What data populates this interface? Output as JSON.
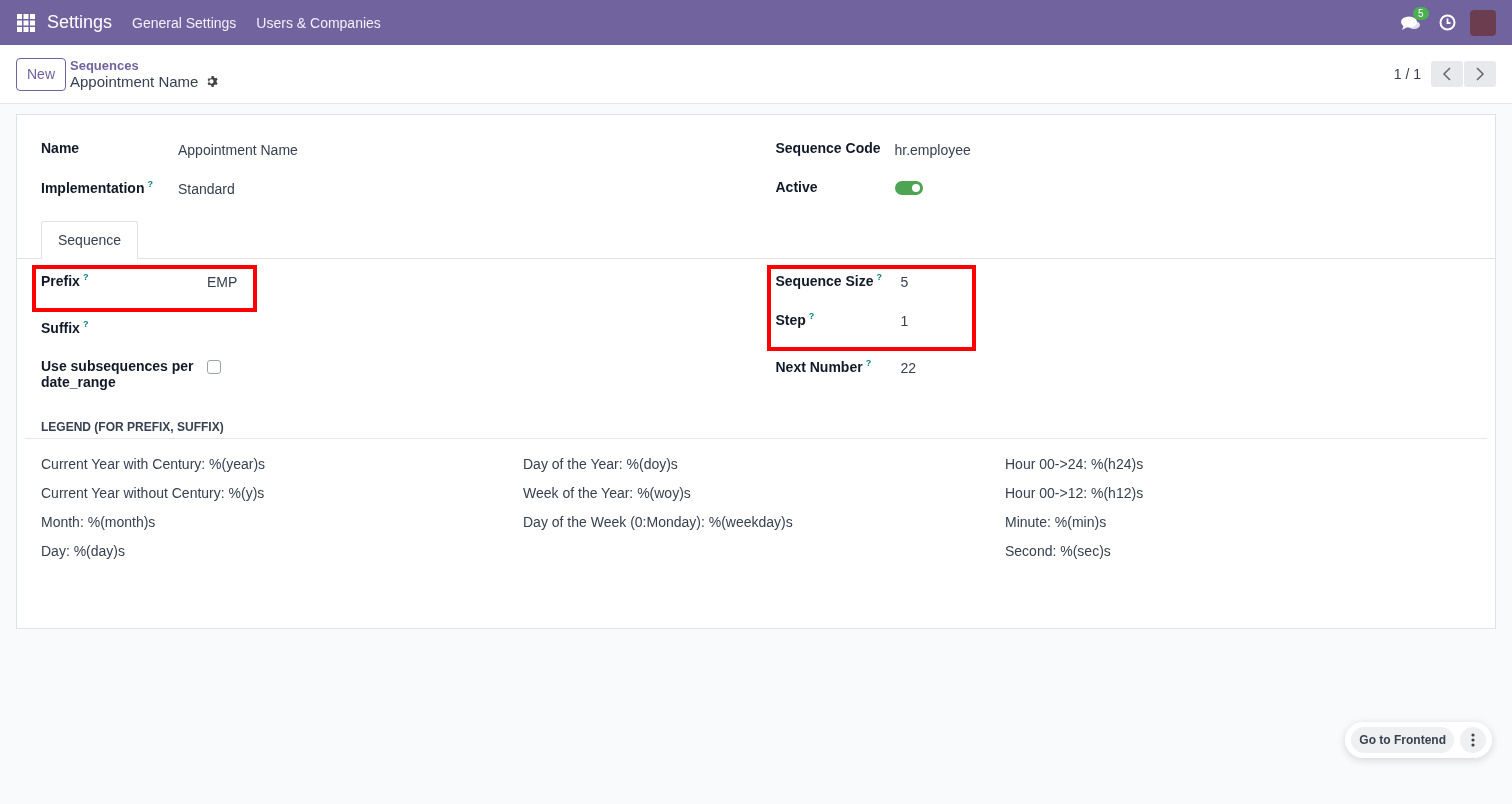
{
  "navbar": {
    "app_title": "Settings",
    "menu": [
      "General Settings",
      "Users & Companies"
    ],
    "chat_badge": "5"
  },
  "control_panel": {
    "new_button": "New",
    "breadcrumb": "Sequences",
    "record_title": "Appointment Name",
    "pager": "1 / 1"
  },
  "header_left": [
    {
      "label": "Name",
      "value": "Appointment Name"
    },
    {
      "label": "Implementation",
      "help": "?",
      "value": "Standard"
    }
  ],
  "header_right": [
    {
      "kind": "text",
      "label": "Sequence Code",
      "value": "hr.employee"
    },
    {
      "kind": "toggle",
      "label": "Active",
      "on": true
    }
  ],
  "tabs": [
    {
      "label": "Sequence",
      "selected": true
    }
  ],
  "left_groups": [
    {
      "highlighted": true,
      "fields": [
        {
          "kind": "text",
          "label": "Prefix",
          "help": "?",
          "value": "EMP"
        }
      ]
    },
    {
      "highlighted": false,
      "fields": [
        {
          "kind": "text",
          "label": "Suffix",
          "help": "?"
        },
        {
          "kind": "checkbox",
          "label": "Use subsequences per date_range",
          "checked": false
        }
      ]
    }
  ],
  "right_groups": [
    {
      "highlighted": true,
      "fields": [
        {
          "kind": "text",
          "label": "Sequence Size",
          "help": "?",
          "value": "5"
        },
        {
          "kind": "text",
          "label": "Step",
          "help": "?",
          "value": "1"
        }
      ]
    },
    {
      "highlighted": false,
      "fields": [
        {
          "kind": "text",
          "label": "Next Number",
          "help": "?",
          "value": "22"
        }
      ]
    }
  ],
  "legend": {
    "title": "LEGEND (FOR PREFIX, SUFFIX)",
    "columns": [
      [
        "Current Year with Century: %(year)s",
        "Current Year without Century: %(y)s",
        "Month: %(month)s",
        "Day: %(day)s"
      ],
      [
        "Day of the Year: %(doy)s",
        "Week of the Year: %(woy)s",
        "Day of the Week (0:Monday): %(weekday)s"
      ],
      [
        "Hour 00->24: %(h24)s",
        "Hour 00->12: %(h12)s",
        "Minute: %(min)s",
        "Second: %(sec)s"
      ]
    ]
  },
  "floating": {
    "button": "Go to Frontend"
  }
}
